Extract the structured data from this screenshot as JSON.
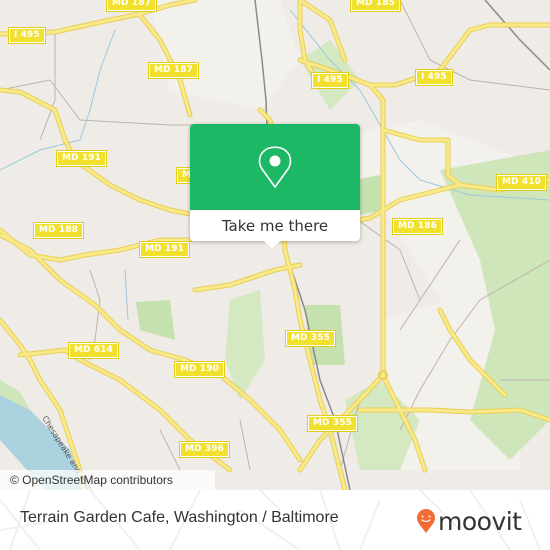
{
  "map": {
    "colors": {
      "background": "#efebe7",
      "residential": "#f2efe9",
      "park": "#c8e6b0",
      "water": "#aad3df",
      "road": "#f7e36a",
      "minor_road": "#b8b0a8",
      "railway": "#8c8c8c"
    },
    "road_labels": [
      {
        "id": "md187-top",
        "text": "MD 187"
      },
      {
        "id": "md185",
        "text": "MD 185"
      },
      {
        "id": "i495-west",
        "text": "I 495"
      },
      {
        "id": "md187",
        "text": "MD 187"
      },
      {
        "id": "i495-center",
        "text": "I 495"
      },
      {
        "id": "i495-east",
        "text": "I 495"
      },
      {
        "id": "md191-north",
        "text": "MD 191"
      },
      {
        "id": "md-partial",
        "text": "M"
      },
      {
        "id": "md410",
        "text": "MD 410"
      },
      {
        "id": "md186",
        "text": "MD 186"
      },
      {
        "id": "md188",
        "text": "MD 188"
      },
      {
        "id": "md191-south",
        "text": "MD 191"
      },
      {
        "id": "md355-north",
        "text": "MD 355"
      },
      {
        "id": "md614",
        "text": "MD 614"
      },
      {
        "id": "md190",
        "text": "MD 190"
      },
      {
        "id": "md355-south",
        "text": "MD 355"
      },
      {
        "id": "md396",
        "text": "MD 396"
      }
    ],
    "waterway_label": "Chesapeake and Ohio Canal",
    "attribution": "© OpenStreetMap contributors"
  },
  "popup": {
    "icon": "location-pin-icon",
    "action_label": "Take me there",
    "color": "#1db866"
  },
  "footer": {
    "place_name": "Terrain Garden Cafe, Washington / Baltimore",
    "brand": "moovit",
    "brand_color": "#f26b35"
  }
}
